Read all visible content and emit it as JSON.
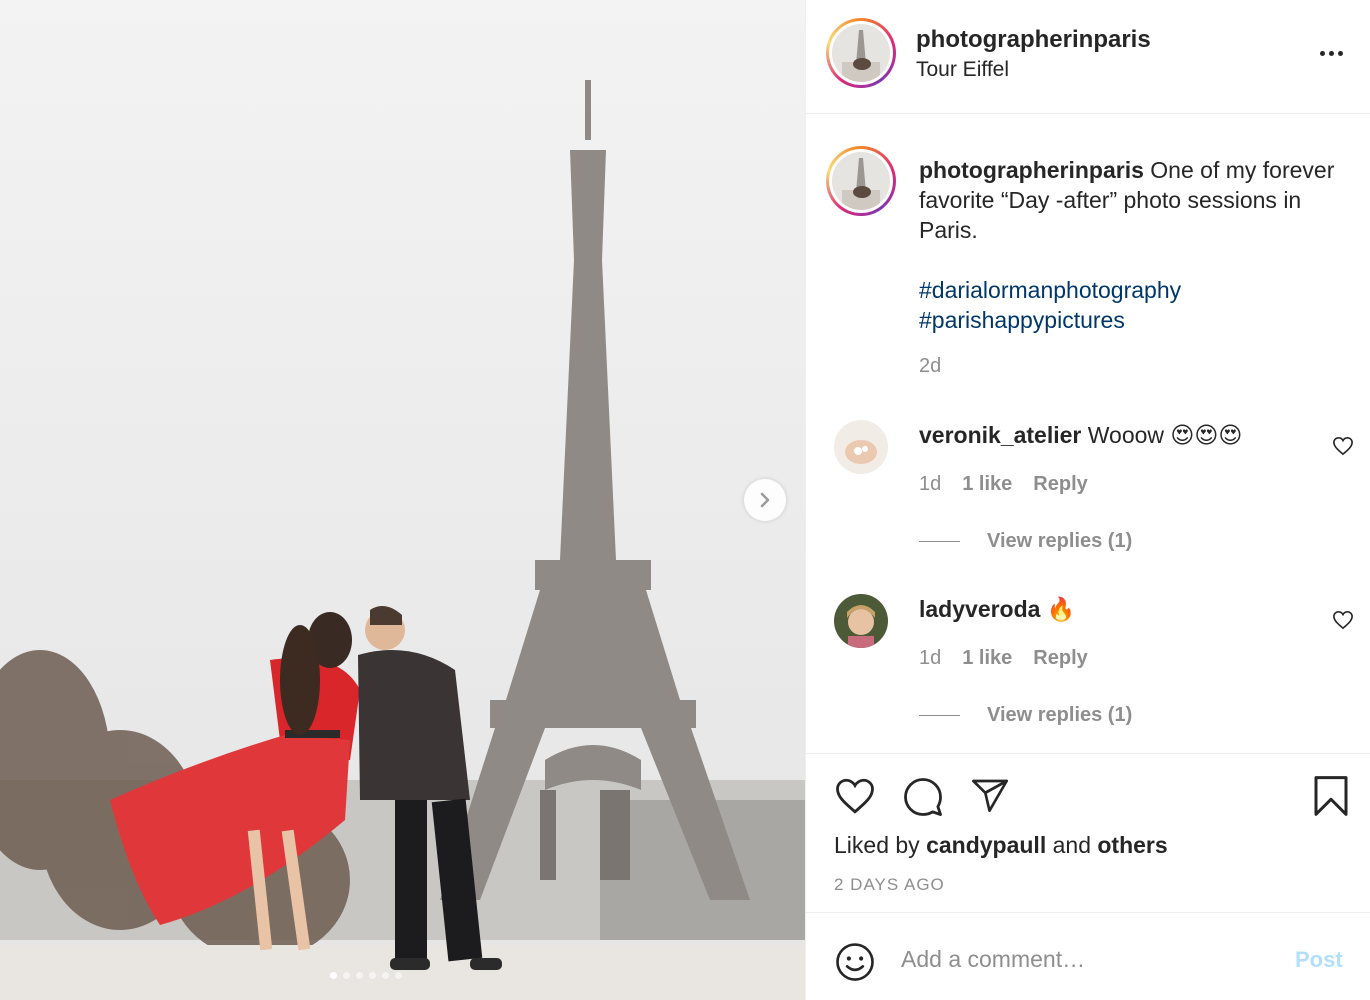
{
  "post": {
    "username": "photographerinparis",
    "location": "Tour Eiffel"
  },
  "caption": {
    "username": "photographerinparis",
    "text": "One of my forever favorite “Day -after” photo sessions in Paris.",
    "hashtags": [
      "#darialormanphotography",
      "#parishappypictures"
    ],
    "time": "2d"
  },
  "comments": [
    {
      "username": "veronik_atelier",
      "text": "Wooow 😍😍😍",
      "time": "1d",
      "likes": "1 like",
      "reply": "Reply",
      "view_replies": "View replies (1)"
    },
    {
      "username": "ladyveroda",
      "text": "🔥",
      "time": "1d",
      "likes": "1 like",
      "reply": "Reply",
      "view_replies": "View replies (1)"
    }
  ],
  "likes": {
    "prefix": "Liked by",
    "user": "candypaull",
    "and": "and",
    "others": "others"
  },
  "date": "2 DAYS AGO",
  "add_comment": {
    "placeholder": "Add a comment…",
    "post_label": "Post"
  },
  "icons": {
    "more": "more-options-icon",
    "like": "heart-icon",
    "comment": "comment-bubble-icon",
    "share": "paper-plane-icon",
    "save": "bookmark-icon",
    "emoji": "emoji-smile-icon",
    "next": "chevron-right-icon"
  },
  "colors": {
    "text": "#262626",
    "secondary": "#8e8e8e",
    "hashtag": "#00376b",
    "post_disabled": "#b2dffc",
    "dress": "#d9262a"
  }
}
